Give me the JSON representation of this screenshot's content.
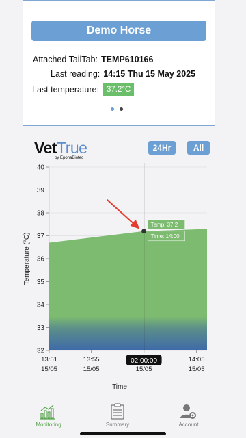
{
  "horse": {
    "name": "Demo Horse"
  },
  "info": {
    "tailtab_label": "Attached TailTab:",
    "tailtab_value": "TEMP610166",
    "reading_label": "Last reading:",
    "reading_value": "14:15 Thu 15 May 2025",
    "temp_label": "Last temperature:",
    "temp_value": "37.2°C"
  },
  "pager": {
    "count": 2,
    "active": 0
  },
  "logo": {
    "vet": "Vet",
    "true": "True",
    "sub": "by EponaBiotec"
  },
  "ranges": {
    "r24": "24Hr",
    "all": "All"
  },
  "tooltip": {
    "temp": "Temp: 37.2",
    "time": "Time: 14:00"
  },
  "cursor": {
    "time_label": "02:00:00"
  },
  "chart_data": {
    "type": "area",
    "ylabel": "Temperature (°C)",
    "xlabel": "Time",
    "ylim": [
      32,
      40
    ],
    "yticks": [
      32,
      33,
      34,
      35,
      36,
      37,
      38,
      39,
      40
    ],
    "x_start": "13:51",
    "x_end": "14:06",
    "xticks": [
      {
        "time": "13:51",
        "label": "13:51",
        "sub": "15/05"
      },
      {
        "time": "13:55",
        "label": "13:55",
        "sub": "15/05"
      },
      {
        "time": "14:05",
        "label": "14:05",
        "sub": "15/05"
      }
    ],
    "cursor_sub": "15/05",
    "series": [
      {
        "x": [
          "13:51",
          "14:00",
          "14:06"
        ],
        "y": [
          36.7,
          37.2,
          37.3
        ]
      }
    ],
    "highlight": {
      "x": "14:00",
      "y": 37.2
    },
    "colors": {
      "fill": "#7dbb70",
      "fill_bottom": "#3e6aa8",
      "line": "#111111",
      "marker": "#333333",
      "arrow": "#e53b2f"
    }
  },
  "nav": [
    {
      "label": "Monitoring",
      "icon": "chart-icon",
      "active": true
    },
    {
      "label": "Summary",
      "icon": "clipboard-icon",
      "active": false
    },
    {
      "label": "Account",
      "icon": "user-gear-icon",
      "active": false
    }
  ],
  "colors": {
    "accent": "#6c9fd3",
    "active_nav": "#5aa64f",
    "inactive_nav": "#777777",
    "temp_badge": "#6cbf6a"
  }
}
